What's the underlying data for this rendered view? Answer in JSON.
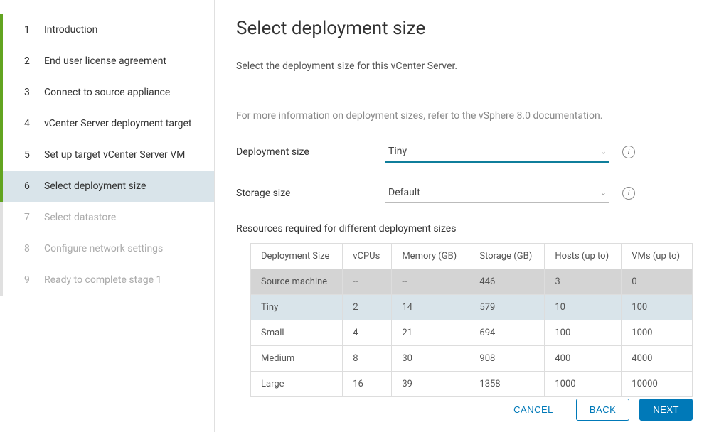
{
  "sidebar": {
    "steps": [
      {
        "num": "1",
        "label": "Introduction",
        "state": "completed"
      },
      {
        "num": "2",
        "label": "End user license agreement",
        "state": "completed"
      },
      {
        "num": "3",
        "label": "Connect to source appliance",
        "state": "completed"
      },
      {
        "num": "4",
        "label": "vCenter Server deployment target",
        "state": "completed"
      },
      {
        "num": "5",
        "label": "Set up target vCenter Server VM",
        "state": "completed"
      },
      {
        "num": "6",
        "label": "Select deployment size",
        "state": "active"
      },
      {
        "num": "7",
        "label": "Select datastore",
        "state": "future"
      },
      {
        "num": "8",
        "label": "Configure network settings",
        "state": "future"
      },
      {
        "num": "9",
        "label": "Ready to complete stage 1",
        "state": "future"
      }
    ]
  },
  "main": {
    "title": "Select deployment size",
    "subtitle": "Select the deployment size for this vCenter Server.",
    "info": "For more information on deployment sizes, refer to the vSphere 8.0 documentation.",
    "deploy_label": "Deployment size",
    "deploy_value": "Tiny",
    "storage_label": "Storage size",
    "storage_value": "Default",
    "table_title": "Resources required for different deployment sizes",
    "table": {
      "headers": [
        "Deployment Size",
        "vCPUs",
        "Memory (GB)",
        "Storage (GB)",
        "Hosts (up to)",
        "VMs (up to)"
      ],
      "rows": [
        {
          "cls": "source-row",
          "cells": [
            "Source machine",
            "--",
            "--",
            "446",
            "3",
            "0"
          ]
        },
        {
          "cls": "selected-row",
          "cells": [
            "Tiny",
            "2",
            "14",
            "579",
            "10",
            "100"
          ]
        },
        {
          "cls": "",
          "cells": [
            "Small",
            "4",
            "21",
            "694",
            "100",
            "1000"
          ]
        },
        {
          "cls": "",
          "cells": [
            "Medium",
            "8",
            "30",
            "908",
            "400",
            "4000"
          ]
        },
        {
          "cls": "",
          "cells": [
            "Large",
            "16",
            "39",
            "1358",
            "1000",
            "10000"
          ]
        }
      ]
    }
  },
  "footer": {
    "cancel": "CANCEL",
    "back": "BACK",
    "next": "NEXT"
  }
}
